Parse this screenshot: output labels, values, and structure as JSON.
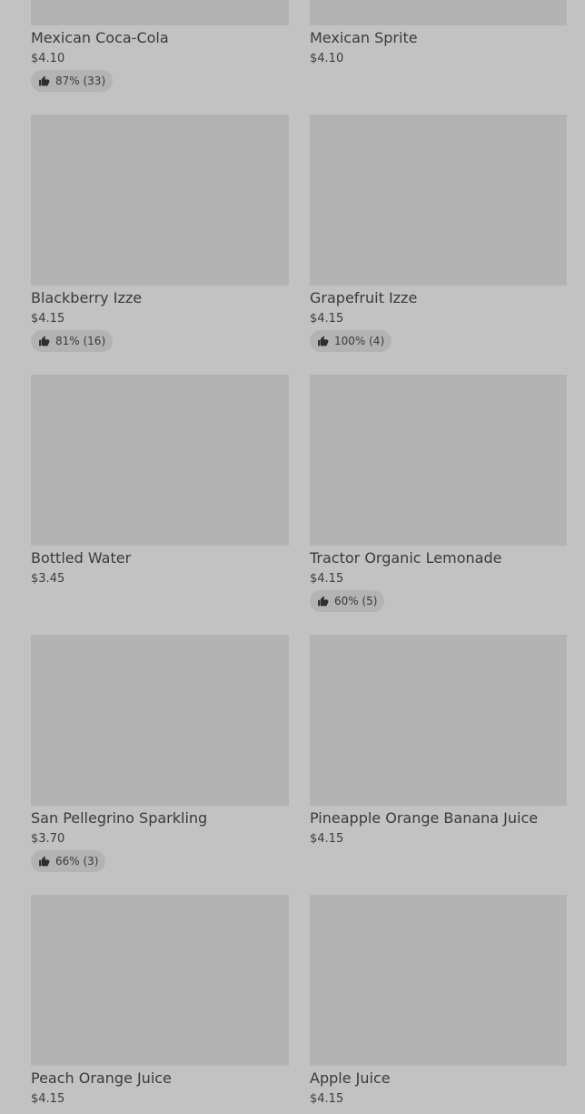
{
  "menu_items": [
    {
      "name": "Mexican Coca-Cola",
      "price": "$4.10",
      "rating": "87% (33)"
    },
    {
      "name": "Mexican Sprite",
      "price": "$4.10",
      "rating": ""
    },
    {
      "name": "Blackberry Izze",
      "price": "$4.15",
      "rating": "81% (16)"
    },
    {
      "name": "Grapefruit Izze",
      "price": "$4.15",
      "rating": "100% (4)"
    },
    {
      "name": "Bottled Water",
      "price": "$3.45",
      "rating": ""
    },
    {
      "name": "Tractor Organic Lemonade",
      "price": "$4.15",
      "rating": "60% (5)"
    },
    {
      "name": "San Pellegrino Sparkling",
      "price": "$3.70",
      "rating": "66% (3)"
    },
    {
      "name": "Pineapple Orange Banana Juice",
      "price": "$4.15",
      "rating": ""
    },
    {
      "name": "Peach Orange Juice",
      "price": "$4.15",
      "rating": ""
    },
    {
      "name": "Apple Juice",
      "price": "$4.15",
      "rating": ""
    }
  ],
  "icons": {
    "rating": "thumbs-up-icon"
  },
  "colors": {
    "background": "#c2c2c2",
    "thumbnail": "#b3b3b3",
    "text": "#3a3a3a"
  }
}
